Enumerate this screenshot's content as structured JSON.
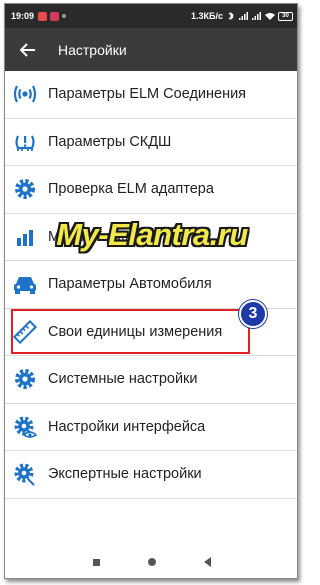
{
  "status_bar": {
    "time": "19:09",
    "net_speed": "1.3КБ/с",
    "battery": "30"
  },
  "toolbar": {
    "title": "Настройки"
  },
  "menu": {
    "items": [
      {
        "label": "Параметры ELM Соединения",
        "icon": "wireless-signal-icon"
      },
      {
        "label": "Параметры СКДШ",
        "icon": "tire-pressure-icon"
      },
      {
        "label": "Проверка ELM адаптера",
        "icon": "gear-icon"
      },
      {
        "label": "Мои профили",
        "icon": "bar-chart-icon"
      },
      {
        "label": "Параметры Автомобиля",
        "icon": "car-icon"
      },
      {
        "label": "Свои единицы измерения",
        "icon": "ruler-icon"
      },
      {
        "label": "Системные настройки",
        "icon": "gear-icon"
      },
      {
        "label": "Настройки интерфейса",
        "icon": "gear-eye-icon"
      },
      {
        "label": "Экспертные настройки",
        "icon": "gear-wrench-icon"
      }
    ]
  },
  "watermark": "My-Elantra.ru",
  "step_badge": "3",
  "accent_color": "#1e73c8",
  "highlight_color": "#e01f26"
}
